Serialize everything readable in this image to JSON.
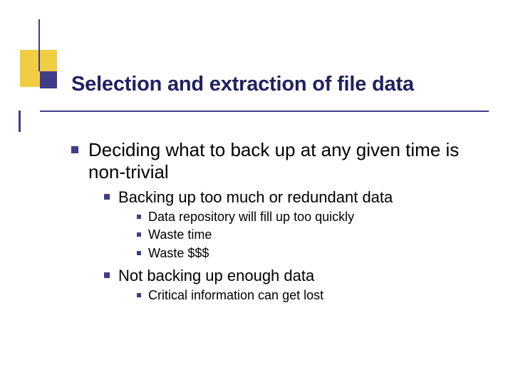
{
  "title": "Selection and extraction of file data",
  "l1_a": "Deciding what to back up at any given time is non-trivial",
  "l2_a": "Backing up too much or redundant data",
  "l3_a": "Data repository will fill up too quickly",
  "l3_b": "Waste time",
  "l3_c": "Waste $$$",
  "l2_b": "Not backing up enough data",
  "l3_d": "Critical information can get lost"
}
